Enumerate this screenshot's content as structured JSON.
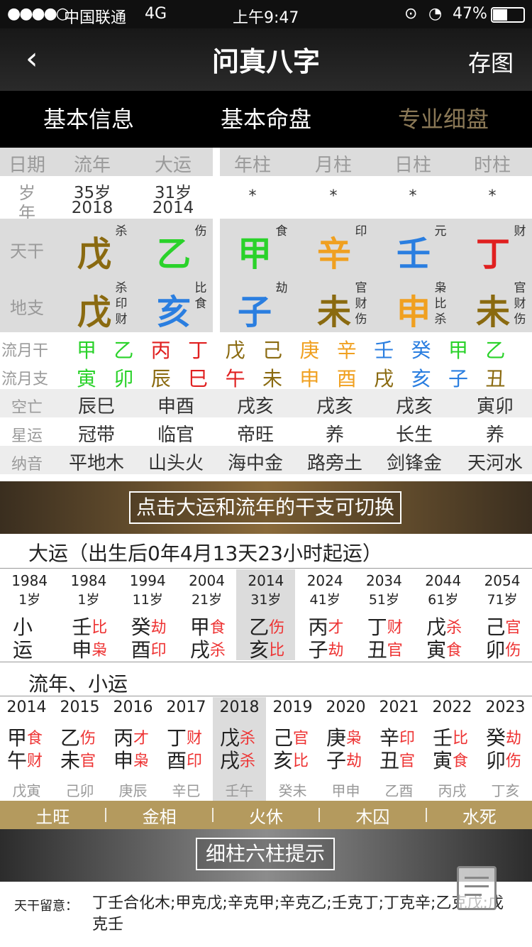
{
  "status": {
    "signal": "●●●●○",
    "carrier": "中国联通",
    "net": "4G",
    "time": "上午9:47",
    "battery": "47%"
  },
  "nav": {
    "back": "‹",
    "title": "问真八字",
    "save": "存图"
  },
  "tabs": [
    {
      "label": "基本信息"
    },
    {
      "label": "基本命盘"
    },
    {
      "label": "专业细盘",
      "active": true
    }
  ],
  "headers": {
    "c1": "日期",
    "c2": "流年",
    "c3": "大运",
    "c4": "年柱",
    "c5": "月柱",
    "c6": "日柱",
    "c7": "时柱"
  },
  "age": {
    "label1": "岁",
    "label2": "年",
    "ln_age": "35岁",
    "ln_year": "2018",
    "dy_age": "31岁",
    "dy_year": "2014",
    "p1": "*",
    "p2": "*",
    "p3": "*",
    "p4": "*"
  },
  "tiangan": {
    "label": "天干",
    "items": [
      {
        "char": "戊",
        "color": "#8a6a10",
        "sup": "杀"
      },
      {
        "char": "乙",
        "color": "#2ad22a",
        "sup": "伤"
      },
      {
        "char": "甲",
        "color": "#2ad22a",
        "sup": "食"
      },
      {
        "char": "辛",
        "color": "#f0a020",
        "sup": "印"
      },
      {
        "char": "壬",
        "color": "#2a7ee0",
        "sup": "元"
      },
      {
        "char": "丁",
        "color": "#e02020",
        "sup": "财"
      }
    ]
  },
  "dizhi": {
    "label": "地支",
    "items": [
      {
        "char": "戊",
        "color": "#8a6a10",
        "sup": [
          "杀",
          "印",
          "财"
        ]
      },
      {
        "char": "亥",
        "color": "#2a7ee0",
        "sup": [
          "比",
          "食"
        ]
      },
      {
        "char": "子",
        "color": "#2a7ee0",
        "sup": [
          "劫"
        ]
      },
      {
        "char": "未",
        "color": "#8a6a10",
        "sup": [
          "官",
          "财",
          "伤"
        ]
      },
      {
        "char": "申",
        "color": "#f0a020",
        "sup": [
          "枭",
          "比",
          "杀"
        ]
      },
      {
        "char": "未",
        "color": "#8a6a10",
        "sup": [
          "官",
          "财",
          "伤"
        ]
      }
    ]
  },
  "liuyuegan": {
    "label": "流月干",
    "items": [
      {
        "c": "甲",
        "color": "#2ad22a"
      },
      {
        "c": "乙",
        "color": "#2ad22a"
      },
      {
        "c": "丙",
        "color": "#e02020"
      },
      {
        "c": "丁",
        "color": "#e02020"
      },
      {
        "c": "戊",
        "color": "#8a6a10"
      },
      {
        "c": "己",
        "color": "#8a6a10"
      },
      {
        "c": "庚",
        "color": "#f0a020"
      },
      {
        "c": "辛",
        "color": "#f0a020"
      },
      {
        "c": "壬",
        "color": "#2a7ee0"
      },
      {
        "c": "癸",
        "color": "#2a7ee0"
      },
      {
        "c": "甲",
        "color": "#2ad22a"
      },
      {
        "c": "乙",
        "color": "#2ad22a"
      }
    ]
  },
  "liuyuezhi": {
    "label": "流月支",
    "items": [
      {
        "c": "寅",
        "color": "#2ad22a"
      },
      {
        "c": "卯",
        "color": "#2ad22a"
      },
      {
        "c": "辰",
        "color": "#8a6a10"
      },
      {
        "c": "巳",
        "color": "#e02020"
      },
      {
        "c": "午",
        "color": "#e02020"
      },
      {
        "c": "未",
        "color": "#8a6a10"
      },
      {
        "c": "申",
        "color": "#f0a020"
      },
      {
        "c": "酉",
        "color": "#f0a020"
      },
      {
        "c": "戌",
        "color": "#8a6a10"
      },
      {
        "c": "亥",
        "color": "#2a7ee0"
      },
      {
        "c": "子",
        "color": "#2a7ee0"
      },
      {
        "c": "丑",
        "color": "#8a6a10"
      }
    ]
  },
  "kongwang": {
    "label": "空亡",
    "vals": [
      "辰巳",
      "申酉",
      "戌亥",
      "戌亥",
      "戌亥",
      "寅卯"
    ]
  },
  "xingyun": {
    "label": "星运",
    "vals": [
      "冠带",
      "临官",
      "帝旺",
      "养",
      "长生",
      "养"
    ]
  },
  "nayin": {
    "label": "纳音",
    "vals": [
      "平地木",
      "山头火",
      "海中金",
      "路旁土",
      "剑锋金",
      "天河水"
    ]
  },
  "banner1": "点击大运和流年的干支可切换",
  "dayun": {
    "title": "大运（出生后0年4月13天23小时起运）",
    "cols": [
      {
        "year": "1984",
        "age": "1岁",
        "g": "小",
        "gs": "",
        "z": "运",
        "zs": ""
      },
      {
        "year": "1984",
        "age": "1岁",
        "g": "壬",
        "gs": "比",
        "z": "申",
        "zs": "枭"
      },
      {
        "year": "1994",
        "age": "11岁",
        "g": "癸",
        "gs": "劫",
        "z": "酉",
        "zs": "印"
      },
      {
        "year": "2004",
        "age": "21岁",
        "g": "甲",
        "gs": "食",
        "z": "戌",
        "zs": "杀"
      },
      {
        "year": "2014",
        "age": "31岁",
        "g": "乙",
        "gs": "伤",
        "z": "亥",
        "zs": "比",
        "sel": true
      },
      {
        "year": "2024",
        "age": "41岁",
        "g": "丙",
        "gs": "才",
        "z": "子",
        "zs": "劫"
      },
      {
        "year": "2034",
        "age": "51岁",
        "g": "丁",
        "gs": "财",
        "z": "丑",
        "zs": "官"
      },
      {
        "year": "2044",
        "age": "61岁",
        "g": "戊",
        "gs": "杀",
        "z": "寅",
        "zs": "食"
      },
      {
        "year": "2054",
        "age": "71岁",
        "g": "己",
        "gs": "官",
        "z": "卯",
        "zs": "伤"
      }
    ]
  },
  "liunian": {
    "title": "流年、小运",
    "cols": [
      {
        "year": "2014",
        "g": "甲",
        "gs": "食",
        "z": "午",
        "zs": "财",
        "xy": "戊寅"
      },
      {
        "year": "2015",
        "g": "乙",
        "gs": "伤",
        "z": "未",
        "zs": "官",
        "xy": "己卯"
      },
      {
        "year": "2016",
        "g": "丙",
        "gs": "才",
        "z": "申",
        "zs": "枭",
        "xy": "庚辰"
      },
      {
        "year": "2017",
        "g": "丁",
        "gs": "财",
        "z": "酉",
        "zs": "印",
        "xy": "辛巳"
      },
      {
        "year": "2018",
        "g": "戊",
        "gs": "杀",
        "z": "戌",
        "zs": "杀",
        "xy": "壬午",
        "sel": true
      },
      {
        "year": "2019",
        "g": "己",
        "gs": "官",
        "z": "亥",
        "zs": "比",
        "xy": "癸未"
      },
      {
        "year": "2020",
        "g": "庚",
        "gs": "枭",
        "z": "子",
        "zs": "劫",
        "xy": "甲申"
      },
      {
        "year": "2021",
        "g": "辛",
        "gs": "印",
        "z": "丑",
        "zs": "官",
        "xy": "乙酉"
      },
      {
        "year": "2022",
        "g": "壬",
        "gs": "比",
        "z": "寅",
        "zs": "食",
        "xy": "丙戌"
      },
      {
        "year": "2023",
        "g": "癸",
        "gs": "劫",
        "z": "卯",
        "zs": "伤",
        "xy": "丁亥"
      }
    ]
  },
  "wuxing": [
    "土旺",
    "金相",
    "火休",
    "木囚",
    "水死"
  ],
  "banner2": "细柱六柱提示",
  "tip": {
    "label": "天干留意：",
    "text": "丁壬合化木;甲克戊;辛克甲;辛克乙;壬克丁;丁克辛;乙克戊;戊克壬"
  }
}
